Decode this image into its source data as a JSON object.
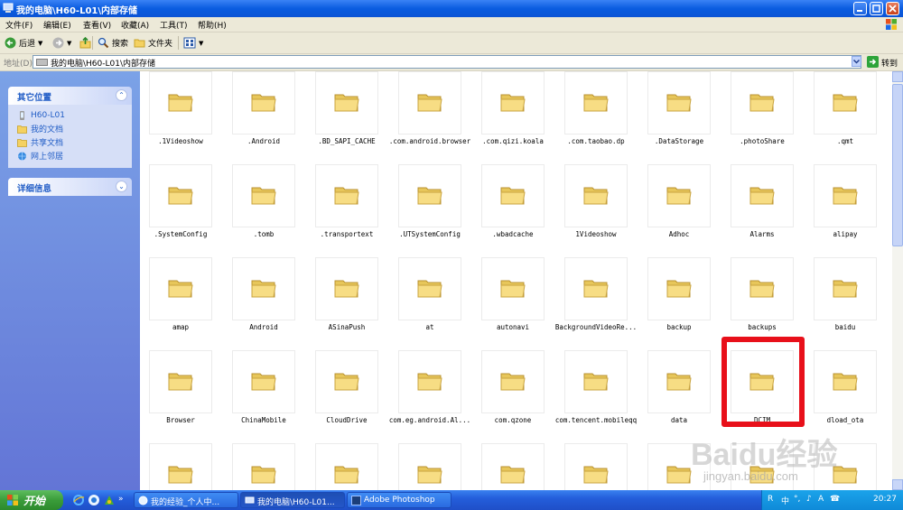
{
  "window": {
    "title": "我的电脑\\H60-L01\\内部存储",
    "controls": [
      "minimize",
      "maximize",
      "close"
    ]
  },
  "menu": [
    "文件(F)",
    "编辑(E)",
    "查看(V)",
    "收藏(A)",
    "工具(T)",
    "帮助(H)"
  ],
  "toolbar": {
    "back_label": "后退",
    "search_label": "搜索",
    "folders_label": "文件夹"
  },
  "address": {
    "label": "地址(D)",
    "path": "我的电脑\\H60-L01\\内部存储",
    "go_label": "转到"
  },
  "taskpane": {
    "other_places": {
      "title": "其它位置",
      "items": [
        {
          "label": "H60-L01",
          "icon": "phone-icon"
        },
        {
          "label": "我的文档",
          "icon": "folder-icon"
        },
        {
          "label": "共享文档",
          "icon": "folder-icon"
        },
        {
          "label": "网上邻居",
          "icon": "network-icon"
        }
      ]
    },
    "details": {
      "title": "详细信息"
    }
  },
  "folders": [
    ".1Videoshow",
    ".Android",
    ".BD_SAPI_CACHE",
    ".com.android.browser",
    ".com.qizi.koala",
    ".com.taobao.dp",
    ".DataStorage",
    ".photoShare",
    ".qmt",
    ".SystemConfig",
    ".tomb",
    ".transportext",
    ".UTSystemConfig",
    ".wbadcache",
    "1Videoshow",
    "Adhoc",
    "Alarms",
    "alipay",
    "amap",
    "Android",
    "ASinaPush",
    "at",
    "autonavi",
    "BackgroundVideoRe...",
    "backup",
    "backups",
    "baidu",
    "Browser",
    "ChinaMobile",
    "CloudDrive",
    "com.eg.android.Al...",
    "com.qzone",
    "com.tencent.mobileqq",
    "data",
    "DCIM",
    "dload_ota",
    "",
    "",
    "",
    "",
    "",
    "",
    "",
    "",
    ""
  ],
  "highlighted_folder": "DCIM",
  "colors": {
    "highlight": "#e8101a",
    "titlebar": "#0a5ce0",
    "taskpane": "#6375d6"
  },
  "watermark": {
    "brand": "Baidu经验",
    "url": "jingyan.baidu.com"
  },
  "taskbar": {
    "start_label": "开始",
    "buttons": [
      {
        "label": "我的经验_个人中...",
        "active": false
      },
      {
        "label": "我的电脑\\H60-L01...",
        "active": true
      },
      {
        "label": "Adobe Photoshop",
        "active": false
      }
    ],
    "tray_items": [
      "R",
      "中",
      "°,",
      "♪",
      "A",
      "☎"
    ],
    "clock": "20:27"
  }
}
